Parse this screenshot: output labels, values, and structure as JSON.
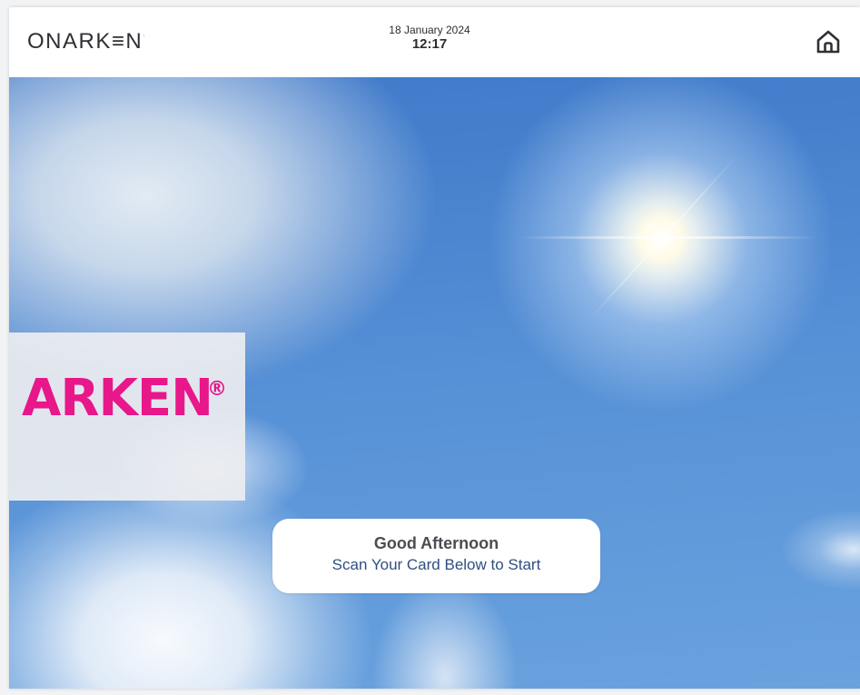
{
  "header": {
    "brand": "ONARK≡N",
    "brand_mark": "·",
    "date": "18 January 2024",
    "time": "12:17",
    "home_icon": "home-icon"
  },
  "hero": {
    "logo_text": "ARKEN",
    "logo_registered": "®",
    "logo_color": "#e8178a"
  },
  "greeting": {
    "title": "Good Afternoon",
    "subtitle": "Scan Your Card Below to Start"
  }
}
